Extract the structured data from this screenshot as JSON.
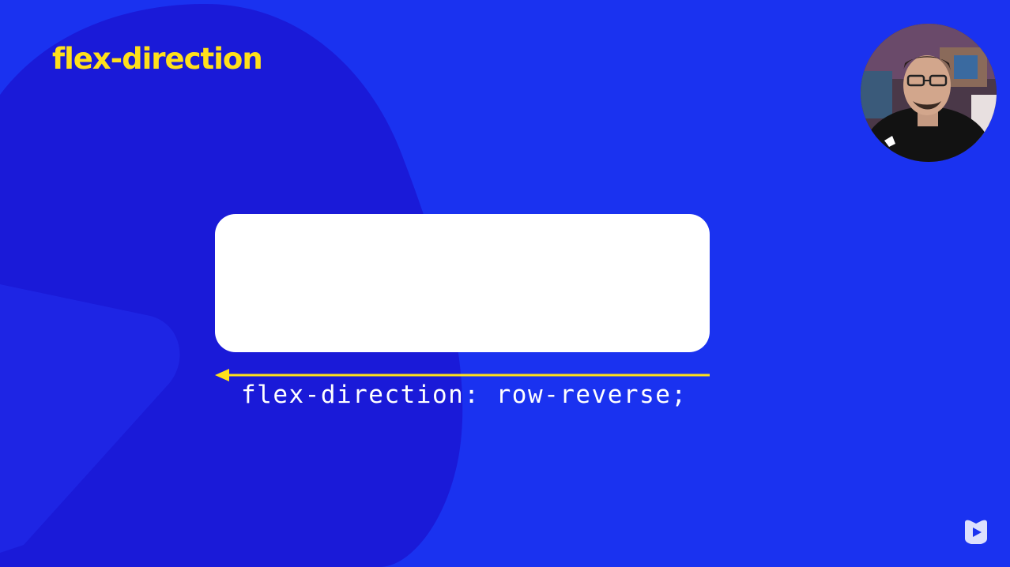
{
  "slide": {
    "title": "flex-direction",
    "code": "flex-direction: row-reverse;"
  },
  "colors": {
    "background": "#1a32f0",
    "background_shape": "#1a1ad8",
    "title": "#ffe01b",
    "arrow": "#ffe01b",
    "box": "#ffffff",
    "code_text": "#ffffff"
  },
  "icons": {
    "arrow": "arrow-left-icon",
    "logo": "play-logo-icon",
    "presenter": "presenter-webcam"
  }
}
